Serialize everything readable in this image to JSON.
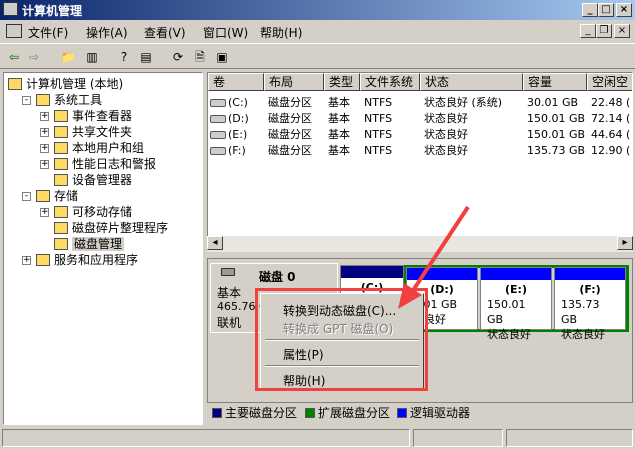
{
  "window": {
    "title": "计算机管理"
  },
  "menu": [
    "文件(F)",
    "操作(A)",
    "查看(V)",
    "窗口(W)",
    "帮助(H)"
  ],
  "tree": [
    {
      "label": "计算机管理 (本地)",
      "level": 0
    },
    {
      "label": "系统工具",
      "level": 1,
      "expander": "-"
    },
    {
      "label": "事件查看器",
      "level": 2,
      "expander": "+"
    },
    {
      "label": "共享文件夹",
      "level": 2,
      "expander": "+"
    },
    {
      "label": "本地用户和组",
      "level": 2,
      "expander": "+"
    },
    {
      "label": "性能日志和警报",
      "level": 2,
      "expander": "+"
    },
    {
      "label": "设备管理器",
      "level": 2
    },
    {
      "label": "存储",
      "level": 1,
      "expander": "-"
    },
    {
      "label": "可移动存储",
      "level": 2,
      "expander": "+"
    },
    {
      "label": "磁盘碎片整理程序",
      "level": 2
    },
    {
      "label": "磁盘管理",
      "level": 2,
      "selected": true
    },
    {
      "label": "服务和应用程序",
      "level": 1,
      "expander": "+"
    }
  ],
  "volumes": {
    "headers": [
      "卷",
      "布局",
      "类型",
      "文件系统",
      "状态",
      "容量",
      "空闲空"
    ],
    "rows": [
      [
        "(C:)",
        "磁盘分区",
        "基本",
        "NTFS",
        "状态良好 (系统)",
        "30.01 GB",
        "22.48 ("
      ],
      [
        "(D:)",
        "磁盘分区",
        "基本",
        "NTFS",
        "状态良好",
        "150.01 GB",
        "72.14 ("
      ],
      [
        "(E:)",
        "磁盘分区",
        "基本",
        "NTFS",
        "状态良好",
        "150.01 GB",
        "44.64 ("
      ],
      [
        "(F:)",
        "磁盘分区",
        "基本",
        "NTFS",
        "状态良好",
        "135.73 GB",
        "12.90 ("
      ]
    ]
  },
  "disk": {
    "name": "磁盘 0",
    "type": "基本",
    "size": "465.76 G",
    "state": "联机",
    "partitions": [
      {
        "label": "(C:)",
        "size": "",
        "status": ""
      },
      {
        "label": "(D:)",
        "size": "0.01 GB",
        "status": "态良好"
      },
      {
        "label": "(E:)",
        "size": "150.01 GB",
        "status": "状态良好"
      },
      {
        "label": "(F:)",
        "size": "135.73 GB",
        "status": "状态良好"
      }
    ]
  },
  "context_menu": [
    {
      "label": "转换到动态磁盘(C)...",
      "enabled": true
    },
    {
      "label": "转换成 GPT 磁盘(O)",
      "enabled": false
    },
    {
      "label": "属性(P)",
      "enabled": true
    },
    {
      "label": "帮助(H)",
      "enabled": true
    }
  ],
  "legend": [
    {
      "label": "主要磁盘分区",
      "color": "#000080"
    },
    {
      "label": "扩展磁盘分区",
      "color": "#008000"
    },
    {
      "label": "逻辑驱动器",
      "color": "#0000ff"
    }
  ],
  "colors": {
    "annotation": "#f04040"
  }
}
